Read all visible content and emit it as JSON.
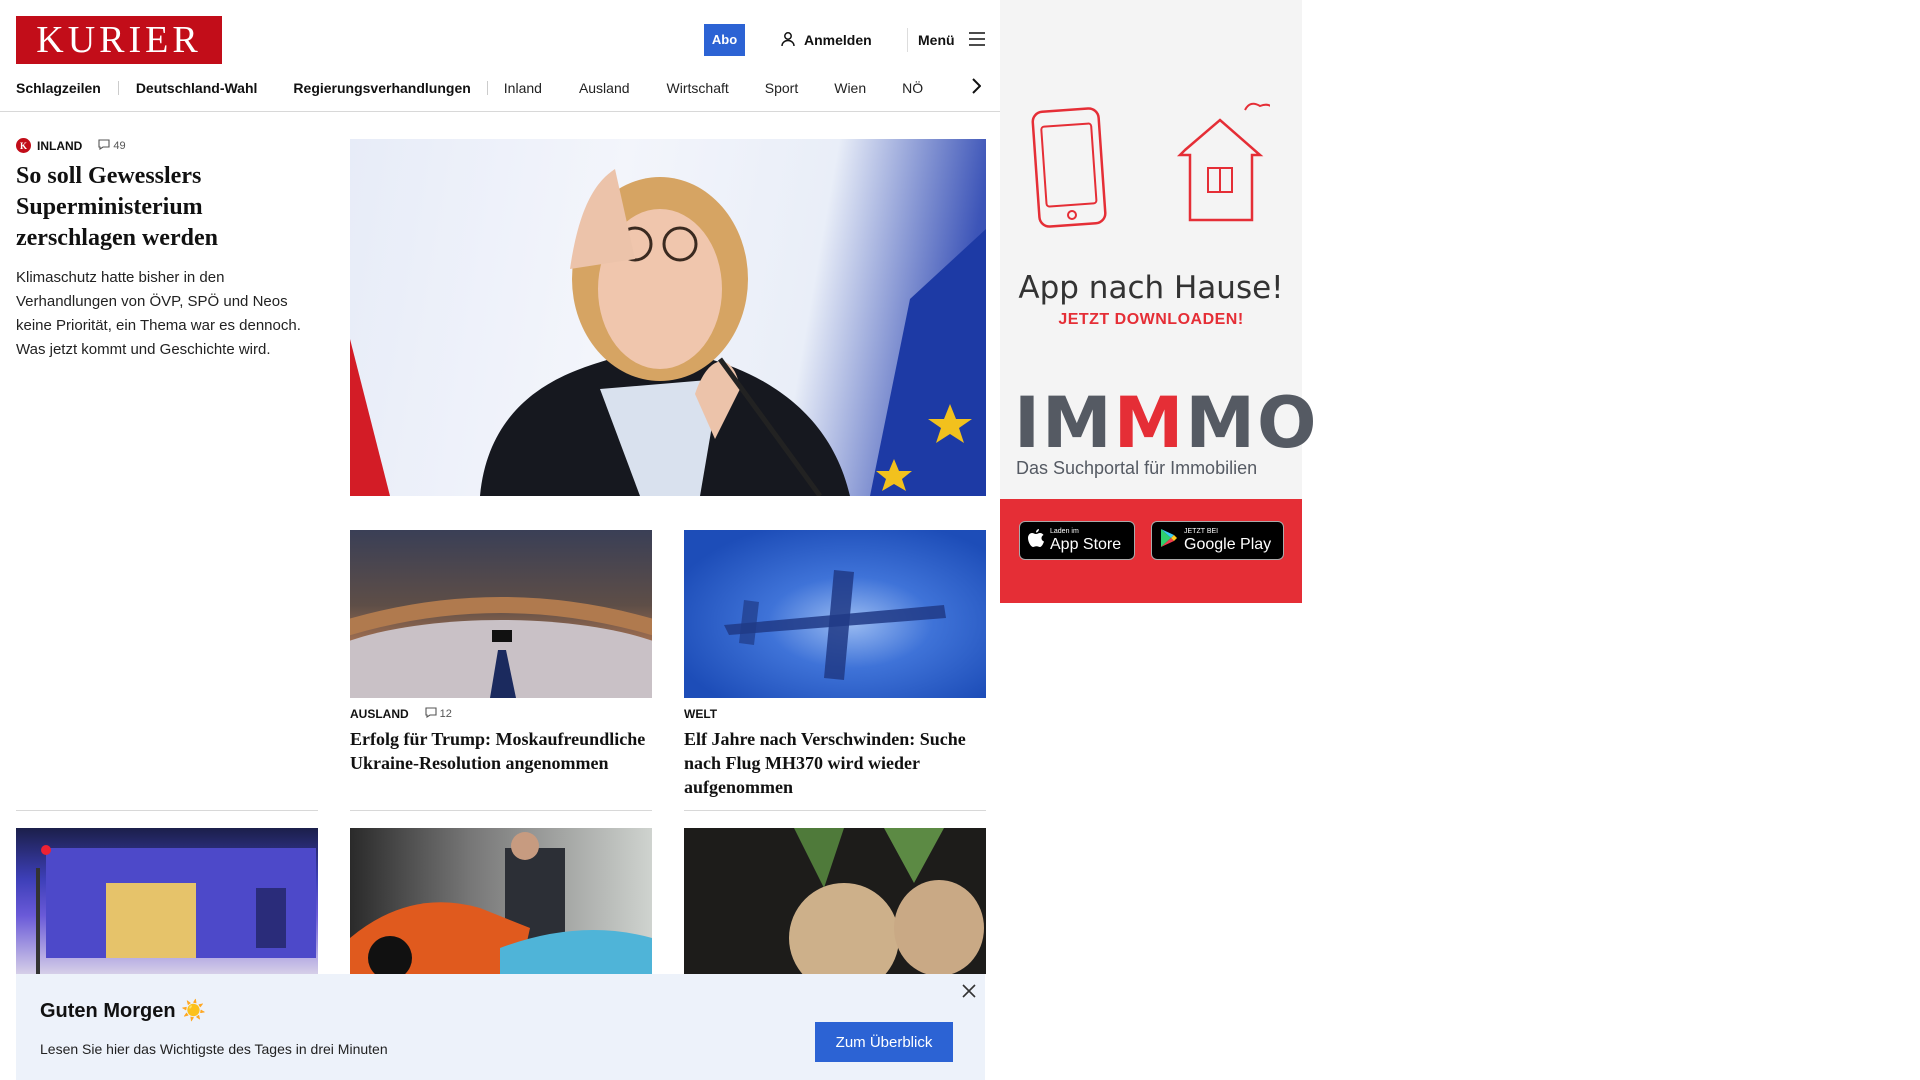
{
  "header": {
    "logo": "KURIER",
    "abo_label": "Abo",
    "login_label": "Anmelden",
    "menu_label": "Menü"
  },
  "nav": [
    {
      "label": "Schlagzeilen",
      "bold": true
    },
    {
      "label": "Deutschland-Wahl",
      "bold": true
    },
    {
      "label": "Regierungsverhandlungen",
      "bold": true
    },
    {
      "label": "Inland",
      "bold": false
    },
    {
      "label": "Ausland",
      "bold": false
    },
    {
      "label": "Wirtschaft",
      "bold": false
    },
    {
      "label": "Sport",
      "bold": false
    },
    {
      "label": "Wien",
      "bold": false
    },
    {
      "label": "NÖ",
      "bold": false
    }
  ],
  "hero": {
    "category": "INLAND",
    "comments": "49",
    "title": "So soll Gewesslers Superministerium zerschlagen werden",
    "teaser": "Klimaschutz hatte bisher in den Verhandlungen von ÖVP, SPÖ und Neos keine Priorität, ein Thema war es dennoch. Was jetzt kommt und Geschichte wird."
  },
  "cards": [
    {
      "category": "AUSLAND",
      "comments": "12",
      "title": "Erfolg für Trump: Moskaufreundliche Ukraine-Resolution angenommen"
    },
    {
      "category": "WELT",
      "comments": "",
      "title": "Elf Jahre nach Verschwinden: Suche nach Flug MH370 wird wieder aufgenommen"
    }
  ],
  "banner": {
    "title": "Guten Morgen ☀️",
    "text": "Lesen Sie hier das Wichtigste des Tages in drei Minuten",
    "button": "Zum Überblick"
  },
  "ad": {
    "headline": "App nach Hause!",
    "sub": "JETZT DOWNLOADEN!",
    "brand_a": "IM",
    "brand_b": "M",
    "brand_c": "MO",
    "brand_sub": "Das Suchportal für Immobilien",
    "appstore_small": "Laden im",
    "appstore_big": "App Store",
    "gplay_small": "JETZT BEI",
    "gplay_big": "Google Play"
  },
  "colors": {
    "brand_red": "#c20d19",
    "accent_blue": "#2c63d4",
    "ad_red": "#e52e36"
  }
}
